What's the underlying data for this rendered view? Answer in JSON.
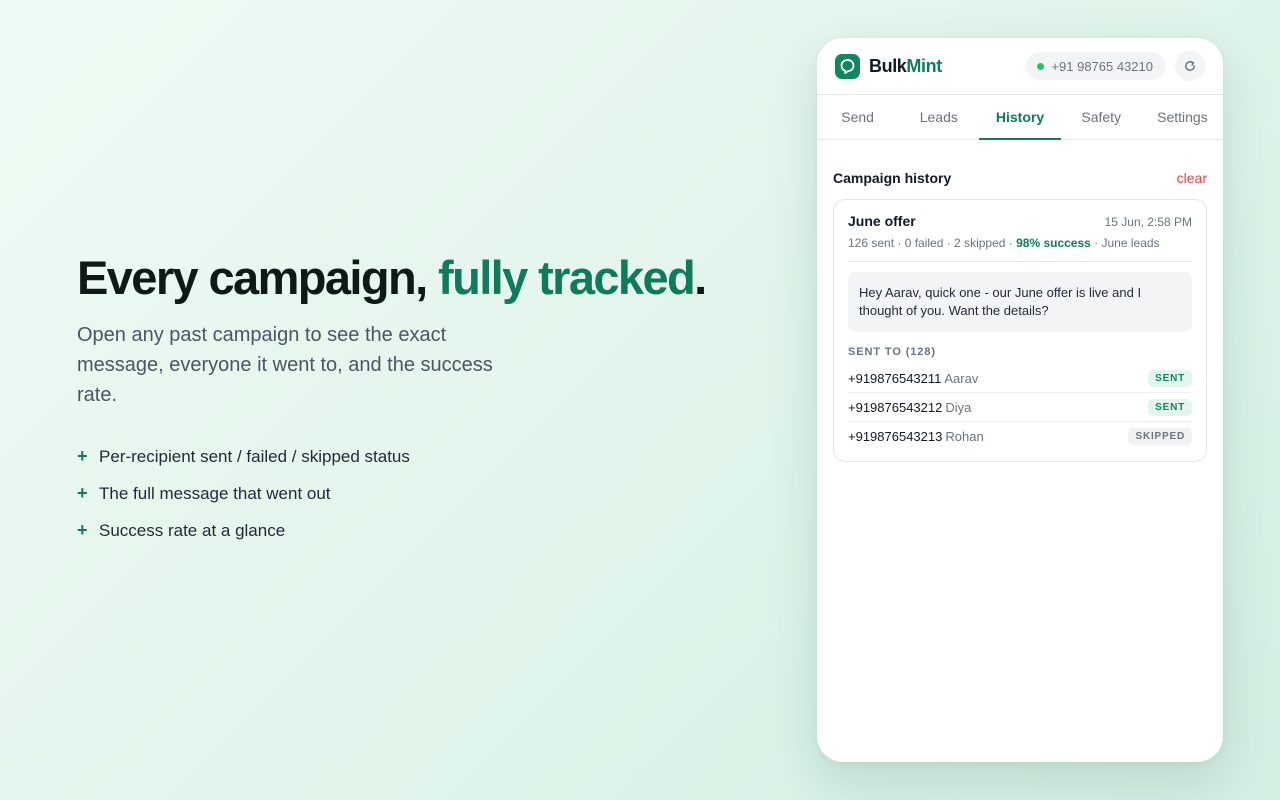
{
  "hero": {
    "headline_part1": "Every campaign, ",
    "headline_accent": "fully tracked",
    "headline_end": ".",
    "subtext": "Open any past campaign to see the exact message, everyone it went to, and the success rate.",
    "features": [
      "Per-recipient sent / failed / skipped status",
      "The full message that went out",
      "Success rate at a glance"
    ]
  },
  "app": {
    "brand_part1": "Bulk",
    "brand_part2": "Mint",
    "phone": "+91 98765 43210",
    "tabs": [
      "Send",
      "Leads",
      "History",
      "Safety",
      "Settings"
    ],
    "active_tab": "History",
    "section_title": "Campaign history",
    "clear_label": "clear",
    "campaign": {
      "title": "June offer",
      "date": "15 Jun, 2:58 PM",
      "stats_prefix": "126 sent · 0 failed · 2 skipped · ",
      "success": "98% success",
      "stats_suffix": " · June leads",
      "message": "Hey Aarav, quick one - our June offer is live and I thought of you. Want the details?",
      "sent_to_label": "SENT TO (128)",
      "recipients": [
        {
          "phone": "+919876543211",
          "name": "Aarav",
          "status": "SENT"
        },
        {
          "phone": "+919876543212",
          "name": "Diya",
          "status": "SENT"
        },
        {
          "phone": "+919876543213",
          "name": "Rohan",
          "status": "SKIPPED"
        }
      ]
    }
  },
  "colors": {
    "accent": "#0f7a5c",
    "danger": "#ef4444",
    "online": "#22c55e"
  },
  "icons": {
    "logo": "chat-bubble-logo-icon",
    "status": "online-dot-icon",
    "refresh": "refresh-icon",
    "bullet": "plus-icon"
  }
}
